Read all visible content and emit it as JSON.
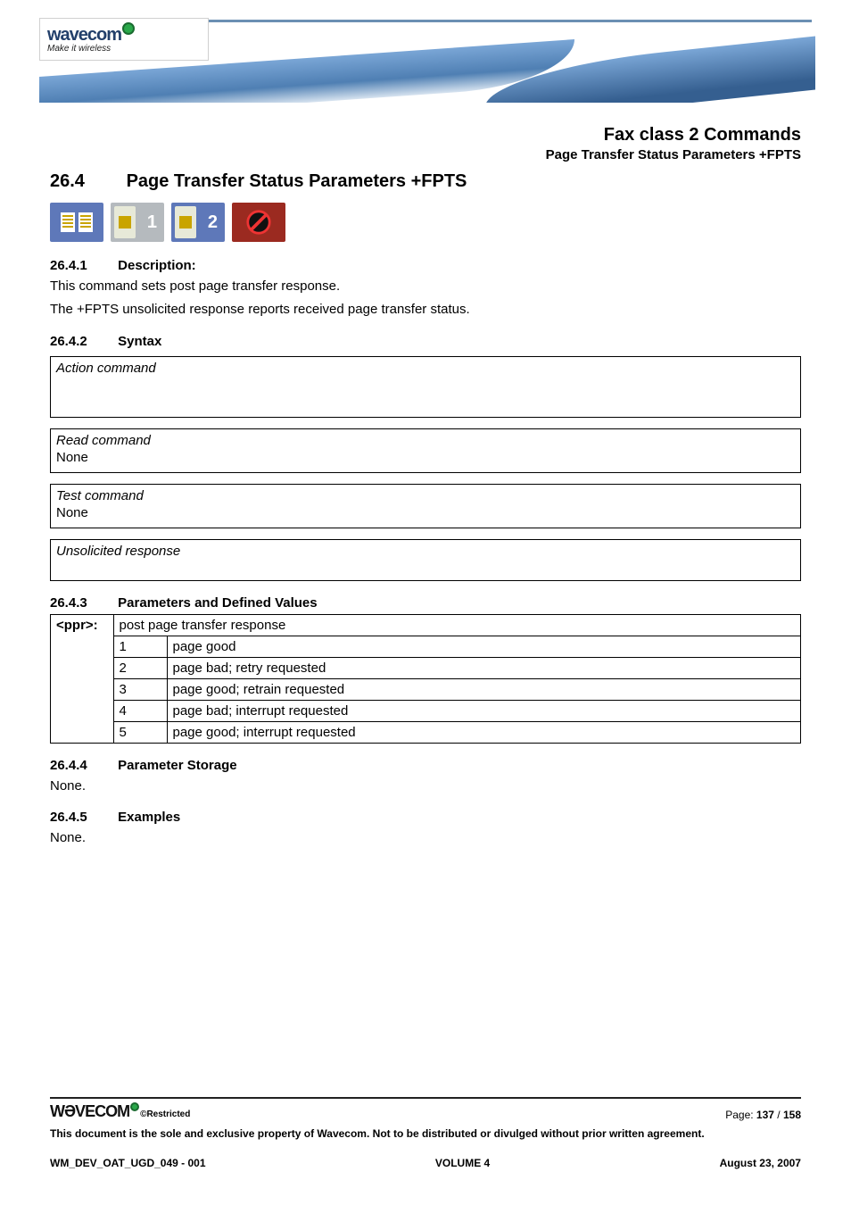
{
  "logo": {
    "wordmark": "wavecom",
    "tagline": "Make it wireless"
  },
  "heading": {
    "chapter_title": "Fax class 2 Commands",
    "section_title": "Page Transfer Status Parameters +FPTS"
  },
  "section": {
    "number": "26.4",
    "title": "Page Transfer Status Parameters +FPTS"
  },
  "icons": {
    "a": "document-clip-icon",
    "b_num": "1",
    "c": "sim-2-icon",
    "c_num": "2",
    "d": "prohibited-icon"
  },
  "subsections": {
    "desc": {
      "num": "26.4.1",
      "title": "Description:"
    },
    "syntax": {
      "num": "26.4.2",
      "title": "Syntax"
    },
    "params": {
      "num": "26.4.3",
      "title": "Parameters and Defined Values"
    },
    "storage": {
      "num": "26.4.4",
      "title": "Parameter Storage"
    },
    "examples": {
      "num": "26.4.5",
      "title": "Examples"
    }
  },
  "description": {
    "line1": "This command sets post page transfer response.",
    "line2": "The +FPTS unsolicited response reports received page transfer status."
  },
  "syntax_boxes": {
    "action": {
      "label": "Action command"
    },
    "read": {
      "label": "Read command",
      "value": "None"
    },
    "test": {
      "label": "Test command",
      "value": "None"
    },
    "unsol": {
      "label": "Unsolicited response"
    }
  },
  "params_table": {
    "param": "<ppr>:",
    "header_desc": "post page transfer response",
    "rows": [
      {
        "val": "1",
        "desc": "page good"
      },
      {
        "val": "2",
        "desc": "page bad; retry requested"
      },
      {
        "val": "3",
        "desc": "page good; retrain requested"
      },
      {
        "val": "4",
        "desc": "page bad; interrupt requested"
      },
      {
        "val": "5",
        "desc": "page good; interrupt requested"
      }
    ]
  },
  "storage_text": "None.",
  "examples_text": "None.",
  "footer": {
    "logo_wordmark": "WƏVECOM",
    "restricted": "©Restricted",
    "page_label": "Page: ",
    "page_cur": "137",
    "page_sep": " / ",
    "page_tot": "158",
    "disclaimer": "This document is the sole and exclusive property of Wavecom. Not to be distributed or divulged without prior written agreement.",
    "docid": "WM_DEV_OAT_UGD_049 - 001",
    "volume": "VOLUME 4",
    "date": "August 23, 2007"
  }
}
